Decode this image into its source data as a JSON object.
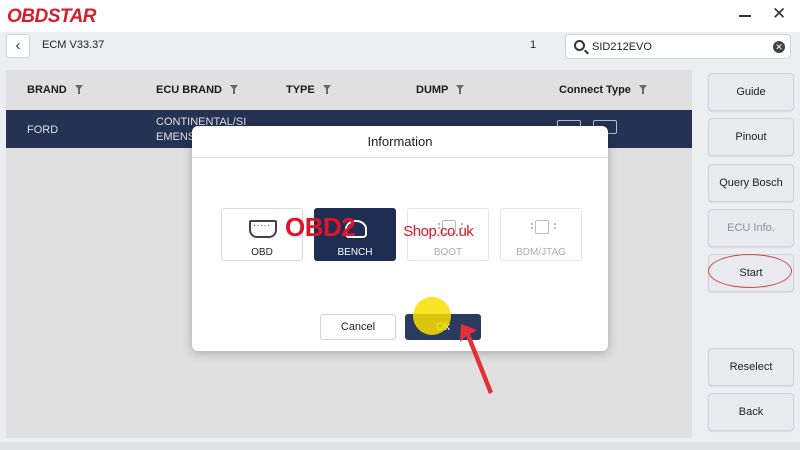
{
  "app": {
    "logo_text": "OBDSTAR"
  },
  "window": {
    "minimize_label": "",
    "close_label": "✕"
  },
  "nav": {
    "back_label": "‹",
    "title": "ECM V33.37",
    "page_number": "1",
    "search": {
      "value": "SID212EVO",
      "placeholder": ""
    }
  },
  "table": {
    "headers": [
      "BRAND",
      "ECU BRAND",
      "TYPE",
      "DUMP",
      "Connect Type"
    ],
    "selected_row": {
      "brand": "FORD",
      "ecu_brand_line1": "CONTINENTAL/SI",
      "ecu_brand_line2": "EMENS/"
    }
  },
  "sidebar": {
    "buttons": [
      {
        "label": "Guide",
        "disabled": false
      },
      {
        "label": "Pinout",
        "disabled": false
      },
      {
        "label": "Query Bosch NO.",
        "disabled": false
      },
      {
        "label": "ECU Info.",
        "disabled": true
      },
      {
        "label": "Start",
        "disabled": false
      },
      {
        "label": "Reselect",
        "disabled": false
      },
      {
        "label": "Back",
        "disabled": false
      }
    ]
  },
  "dialog": {
    "title": "Information",
    "options": [
      {
        "label": "OBD",
        "state": "normal",
        "icon": "obd-port-icon"
      },
      {
        "label": "BENCH",
        "state": "selected",
        "icon": "bench-icon"
      },
      {
        "label": "BOOT",
        "state": "disabled",
        "icon": "chip-icon"
      },
      {
        "label": "BDM/JTAG",
        "state": "disabled",
        "icon": "chip-icon"
      }
    ],
    "cancel_label": "Cancel",
    "ok_label": "Ok"
  },
  "watermark": {
    "brand": "OBD2",
    "suffix": "Shop.co.uk"
  },
  "colors": {
    "accent": "#2b3a5f",
    "logo": "#d3202a",
    "highlight": "#d9414a"
  }
}
